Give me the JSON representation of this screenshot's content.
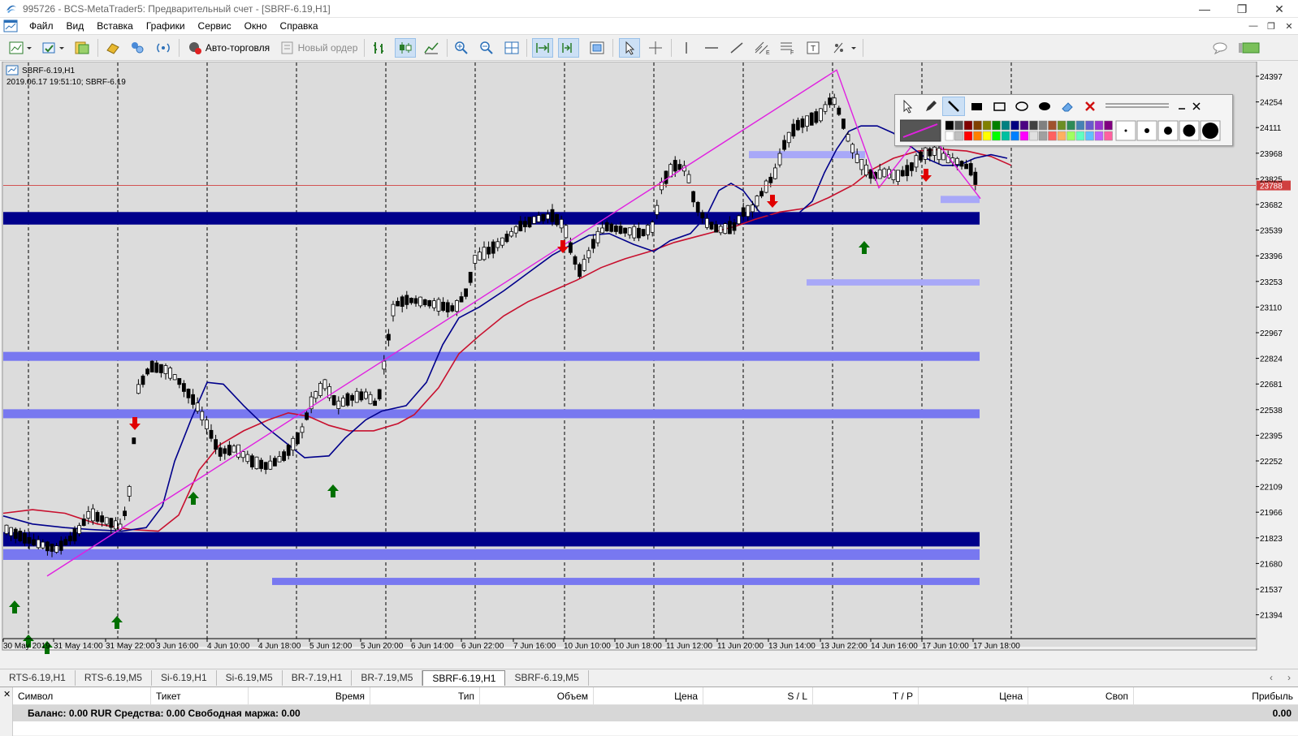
{
  "window": {
    "title": "995726 - BCS-MetaTrader5: Предварительный счет - [SBRF-6.19,H1]",
    "controls": [
      "—",
      "❐",
      "✕"
    ]
  },
  "menu": {
    "items": [
      "Файл",
      "Вид",
      "Вставка",
      "Графики",
      "Сервис",
      "Окно",
      "Справка"
    ],
    "mdi_controls": [
      "—",
      "❐",
      "✕"
    ]
  },
  "toolbar": {
    "autotrade_label": "Авто-торговля",
    "new_order_label": "Новый ордер"
  },
  "chart": {
    "symbol_label": "SBRF-6.19,H1",
    "info_line": "2019.06.17 19:51:10; SBRF-6.19",
    "current_price_label": "23788",
    "price_ticks": [
      "24397",
      "24254",
      "24111",
      "23968",
      "23825",
      "23682",
      "23539",
      "23396",
      "23253",
      "23110",
      "22967",
      "22824",
      "22681",
      "22538",
      "22395",
      "22252",
      "22109",
      "21966",
      "21823",
      "21680",
      "21537",
      "21394"
    ],
    "time_ticks": [
      "30 May 2019",
      "31 May 14:00",
      "31 May 22:00",
      "3 Jun 16:00",
      "4 Jun 10:00",
      "4 Jun 18:00",
      "5 Jun 12:00",
      "5 Jun 20:00",
      "6 Jun 14:00",
      "6 Jun 22:00",
      "7 Jun 16:00",
      "10 Jun 10:00",
      "10 Jun 18:00",
      "11 Jun 12:00",
      "11 Jun 20:00",
      "13 Jun 14:00",
      "13 Jun 22:00",
      "14 Jun 16:00",
      "17 Jun 10:00",
      "17 Jun 18:00"
    ],
    "colors": {
      "background": "#dcdcdc",
      "bull_candle": "#ffffff",
      "bear_candle": "#000000",
      "ma_fast": "#00008b",
      "ma_slow": "#c8102e",
      "trendline": "#e020e0",
      "zone_light": "#7878f0",
      "zone_dark": "#00008b",
      "arrow_up": "#007000",
      "arrow_down": "#e00000",
      "price_line": "#d04040"
    }
  },
  "tabs": {
    "items": [
      "RTS-6.19,H1",
      "RTS-6.19,M5",
      "Si-6.19,H1",
      "Si-6.19,M5",
      "BR-7.19,H1",
      "BR-7.19,M5",
      "SBRF-6.19,H1",
      "SBRF-6.19,M5"
    ],
    "active_index": 6
  },
  "terminal": {
    "columns": [
      "Символ",
      "Тикет",
      "Время",
      "Тип",
      "Объем",
      "Цена",
      "S / L",
      "T / P",
      "Цена",
      "Своп",
      "Прибыль"
    ],
    "balance_line": "Баланс: 0.00 RUR  Средства: 0.00  Свободная маржа: 0.00",
    "profit_total": "0.00"
  }
}
